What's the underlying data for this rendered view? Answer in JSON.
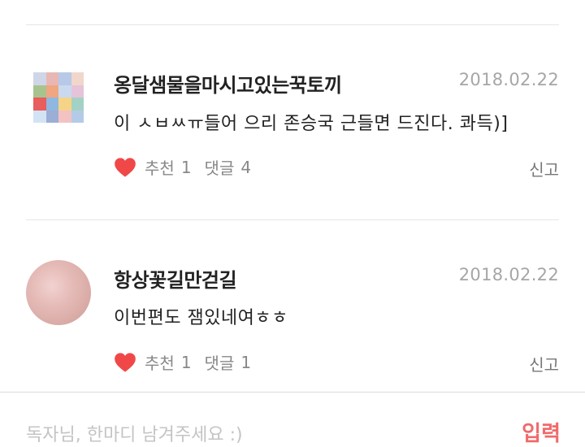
{
  "comments": [
    {
      "username": "옹달샘물을마시고있는꾹토끼",
      "date": "2018.02.22",
      "text": "이 ㅅㅂㅆㅠ들어 으리 존승국 근들면 드진다. 콰득)]",
      "recommend_label": "추천",
      "recommend_count": "1",
      "reply_label": "댓글",
      "reply_count": "4",
      "report_label": "신고",
      "avatar": "photo-collage"
    },
    {
      "username": "항상꽃길만걷길",
      "date": "2018.02.22",
      "text": "이번편도 잼있네여ㅎㅎ",
      "recommend_label": "추천",
      "recommend_count": "1",
      "reply_label": "댓글",
      "reply_count": "1",
      "report_label": "신고",
      "avatar": "pink-blur"
    }
  ],
  "input": {
    "placeholder": "독자님, 한마디 남겨주세요 :)",
    "submit_label": "입력"
  },
  "colors": {
    "heart": "#f04848",
    "submit": "#f06a6a",
    "date": "#a6a6a6"
  },
  "icons": {
    "like": "heart-icon"
  }
}
